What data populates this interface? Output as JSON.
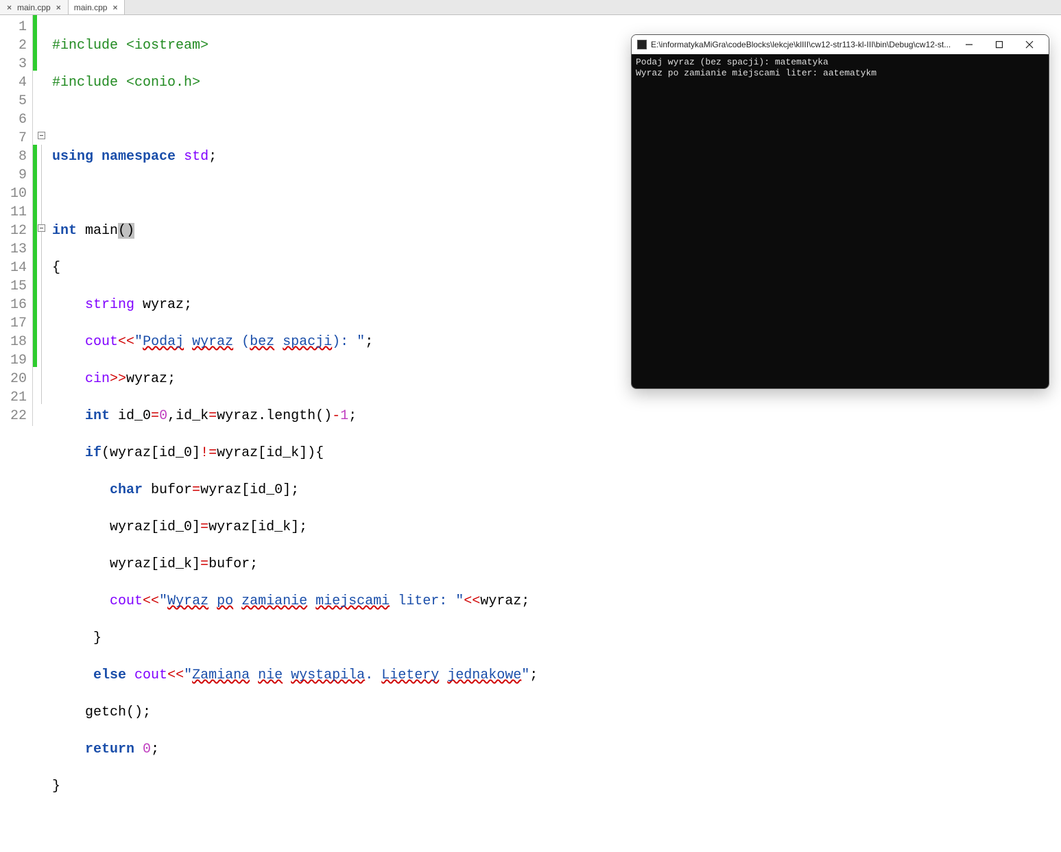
{
  "tabs": [
    {
      "label": "main.cpp",
      "active": false
    },
    {
      "label": "main.cpp",
      "active": true
    }
  ],
  "code": {
    "lines": 22,
    "l1_include1": "#include <iostream>",
    "l2_include2": "#include <conio.h>",
    "l4_kw_using": "using",
    "l4_kw_namespace": "namespace",
    "l4_std": "std",
    "semi": ";",
    "l6_kw_int": "int",
    "l6_main": "main",
    "l6_parens_open": "(",
    "l6_parens_close": ")",
    "l7_brace_open": "{",
    "l8_string": "string",
    "l8_wyraz": "wyraz",
    "l9_cout": "cout",
    "l9_opshift": "<<",
    "l9_str_a": "\"",
    "l9_str_podaj": "Podaj",
    "l9_str_space1": " ",
    "l9_str_wyraz": "wyraz",
    "l9_str_space2": " (",
    "l9_str_bez": "bez",
    "l9_str_space3": " ",
    "l9_str_spacji": "spacji",
    "l9_str_tail": "): \"",
    "l10_cin": "cin",
    "l10_opin": ">>",
    "l10_wyraz": "wyraz",
    "l11_int": "int",
    "l11_rest": " id_0",
    "l11_eq": "=",
    "l11_zero": "0",
    "l11_comma_idk": ",id_k",
    "l11_wyraz_len": "wyraz.length()",
    "l11_minus": "-",
    "l11_one": "1",
    "l12_if": "if",
    "l12_cond": "(wyraz[id_0]",
    "l12_neq": "!=",
    "l12_cond2": "wyraz[id_k]){",
    "l13_char": "char",
    "l13_buf": " bufor",
    "l13_rest": "wyraz[id_0];",
    "l14": "wyraz[id_0]",
    "l14_eq": "=",
    "l14b": "wyraz[id_k];",
    "l15": "wyraz[id_k]",
    "l15_eq": "=",
    "l15b": "bufor;",
    "l16_cout": "cout",
    "l16_shift": "<<",
    "l16_str_a": "\"",
    "l16_w1": "Wyraz",
    "l16_sp": " ",
    "l16_w2": "po",
    "l16_w3": "zamianie",
    "l16_w4": "miejscami",
    "l16_tail": " liter: \"",
    "l16_wyraz": "wyraz",
    "l17_brace": "}",
    "l18_else": "else",
    "l18_cout": "cout",
    "l18_shift": "<<",
    "l18_str_a": "\"",
    "l18_w1": "Zamiana",
    "l18_w2": "nie",
    "l18_w3": "wystapila",
    "l18_dot": ". ",
    "l18_w4": "Lietery",
    "l18_w5": "jednakowe",
    "l18_str_b": "\"",
    "l19_getch": "getch();",
    "l20_return": "return",
    "l20_zero": "0",
    "l21_brace_close": "}"
  },
  "console": {
    "title": "E:\\informatykaMiGra\\codeBlocks\\lekcje\\klIII\\cw12-str113-kl-III\\bin\\Debug\\cw12-st...",
    "line1": "Podaj wyraz (bez spacji): matematyka",
    "line2": "Wyraz po zamianie miejscami liter: aatematykm"
  }
}
